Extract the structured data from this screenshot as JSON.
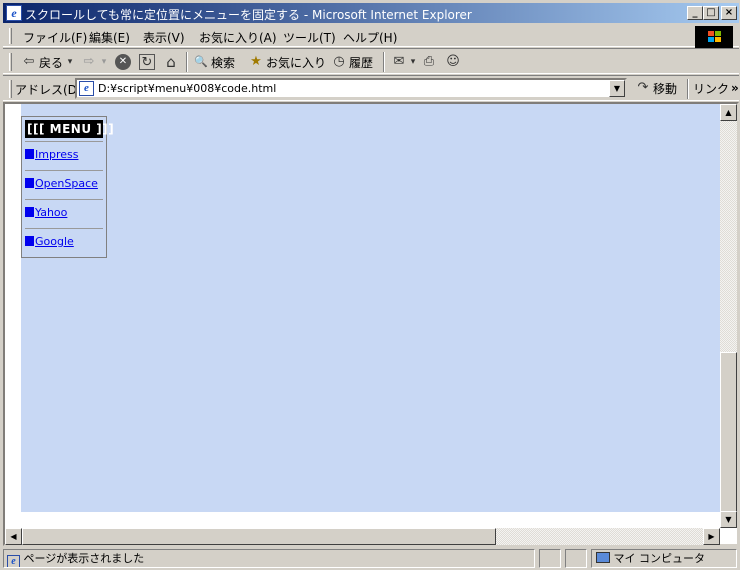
{
  "window": {
    "title": "スクロールしても常に定位置にメニューを固定する - Microsoft Internet Explorer",
    "app_icon": "ie-page-icon",
    "controls": [
      "minimize",
      "maximize",
      "close"
    ]
  },
  "menubar": {
    "items": [
      "ファイル(F)",
      "編集(E)",
      "表示(V)",
      "お気に入り(A)",
      "ツール(T)",
      "ヘルプ(H)"
    ]
  },
  "toolbar": {
    "back": "戻る",
    "search": "検索",
    "favorites": "お気に入り",
    "history": "履歴"
  },
  "address": {
    "label": "アドレス(D)",
    "url": "D:¥script¥menu¥008¥code.html",
    "go": "移動",
    "links": "リンク",
    "more": "»"
  },
  "page": {
    "background": "#c8d8f4",
    "menu": {
      "title": "[[[ MENU ]]]",
      "items": [
        "Impress",
        "OpenSpace",
        "Yahoo",
        "Google"
      ],
      "link_color": "#0000ee"
    }
  },
  "statusbar": {
    "text": "ページが表示されました",
    "zone": "マイ コンピュータ"
  },
  "glyphs": {
    "back_arrow": "⇦",
    "dropdown": "▾",
    "forward_arrow": "⇨",
    "stop": "✕",
    "refresh": "↻",
    "home": "⌂",
    "search": "🔍",
    "favorites": "★",
    "history": "◷",
    "mail": "✉",
    "print": "⎙",
    "messenger": "☺",
    "go_arrow": "↷",
    "scroll_up": "▲",
    "scroll_down": "▼",
    "scroll_left": "◀",
    "scroll_right": "▶"
  }
}
